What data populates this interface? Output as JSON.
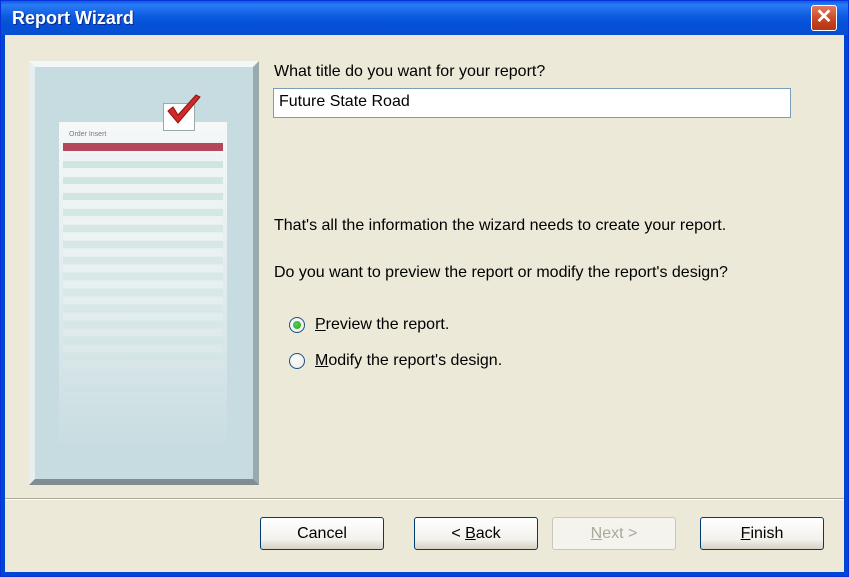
{
  "window": {
    "title": "Report Wizard",
    "close_icon": "close-icon"
  },
  "illustration": {
    "sheet_title": "Order Insert",
    "header_color": "#B3475B",
    "check_icon": "checkmark-icon"
  },
  "main": {
    "title_prompt": "What title do you want for your report?",
    "title_value": "Future State Road",
    "info_text": "That's all the information the wizard needs to create your report.",
    "question_text": "Do you want to preview the report or modify the report's design?",
    "options": [
      {
        "mnemonic": "P",
        "rest": "review the report.",
        "selected": true
      },
      {
        "mnemonic": "M",
        "rest": "odify the report's design.",
        "selected": false
      }
    ]
  },
  "buttons": {
    "cancel": "Cancel",
    "back_prefix": "< ",
    "back_mnemonic": "B",
    "back_rest": "ack",
    "next_mnemonic": "N",
    "next_rest": "ext >",
    "finish_mnemonic": "F",
    "finish_rest": "inish"
  }
}
